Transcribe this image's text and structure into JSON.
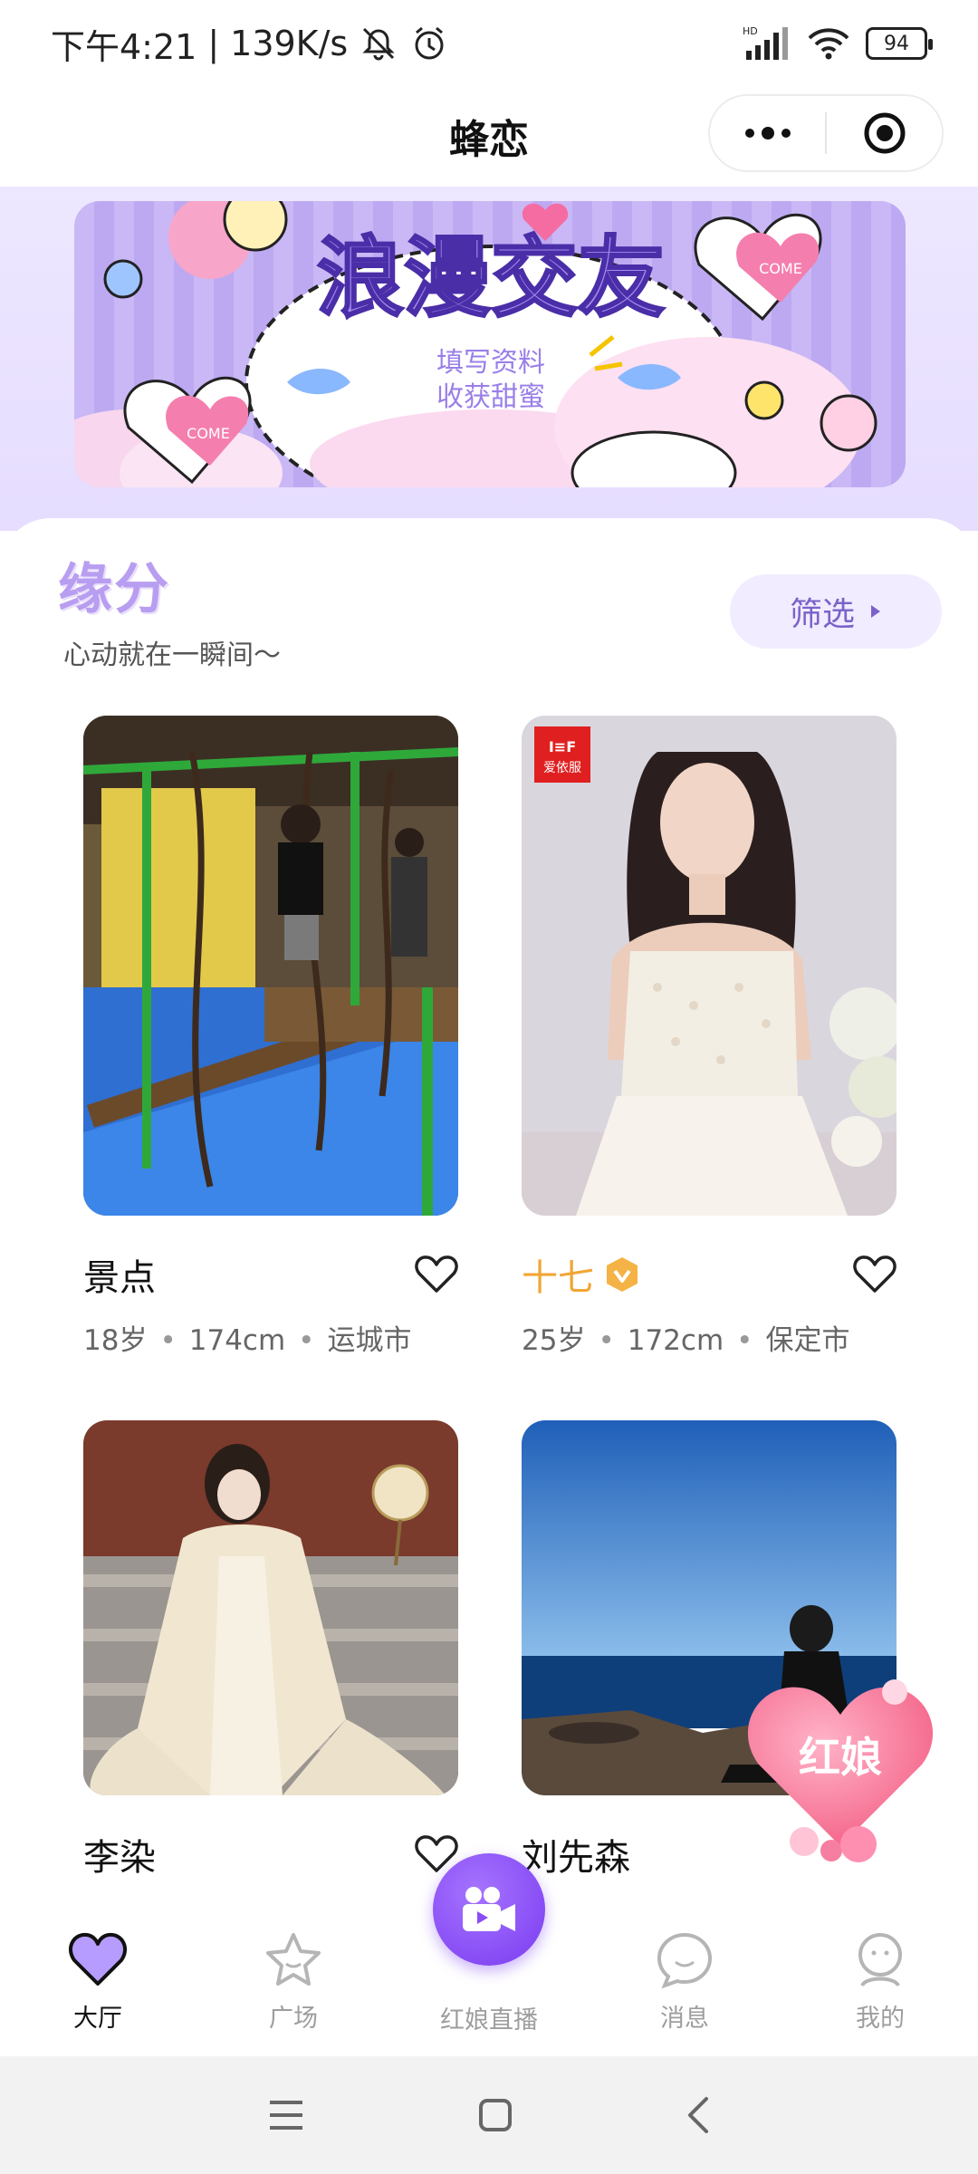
{
  "status_bar": {
    "time": "下午4:21",
    "speed": "139K/s",
    "battery": "94"
  },
  "title_bar": {
    "title": "蜂恋"
  },
  "banner": {
    "headline": "浪漫交友",
    "line1": "填写资料",
    "line2": "收获甜蜜",
    "sticker_text": "COME"
  },
  "section": {
    "title": "缘分",
    "subtitle": "心动就在一瞬间～",
    "filter_label": "筛选"
  },
  "profiles": [
    {
      "name": "景点",
      "age": "18岁",
      "height": "174cm",
      "city": "运城市",
      "verified": false
    },
    {
      "name": "十七",
      "age": "25岁",
      "height": "172cm",
      "city": "保定市",
      "verified": true,
      "brand_tag": "爱依服"
    },
    {
      "name": "李染",
      "age": "",
      "height": "",
      "city": "",
      "verified": false
    },
    {
      "name": "刘先森",
      "age": "",
      "height": "",
      "city": "",
      "verified": false
    }
  ],
  "matchmaker": {
    "label": "红娘"
  },
  "tabs": [
    {
      "label": "大厅",
      "icon": "heart-icon",
      "active": true
    },
    {
      "label": "广场",
      "icon": "star-icon",
      "active": false
    },
    {
      "label": "红娘直播",
      "icon": "video-camera-icon",
      "active": false
    },
    {
      "label": "消息",
      "icon": "chat-bubble-icon",
      "active": false
    },
    {
      "label": "我的",
      "icon": "person-icon",
      "active": false
    }
  ],
  "colors": {
    "accent": "#7b62c9",
    "vip": "#f0a634",
    "live": "#8a4cf5"
  }
}
